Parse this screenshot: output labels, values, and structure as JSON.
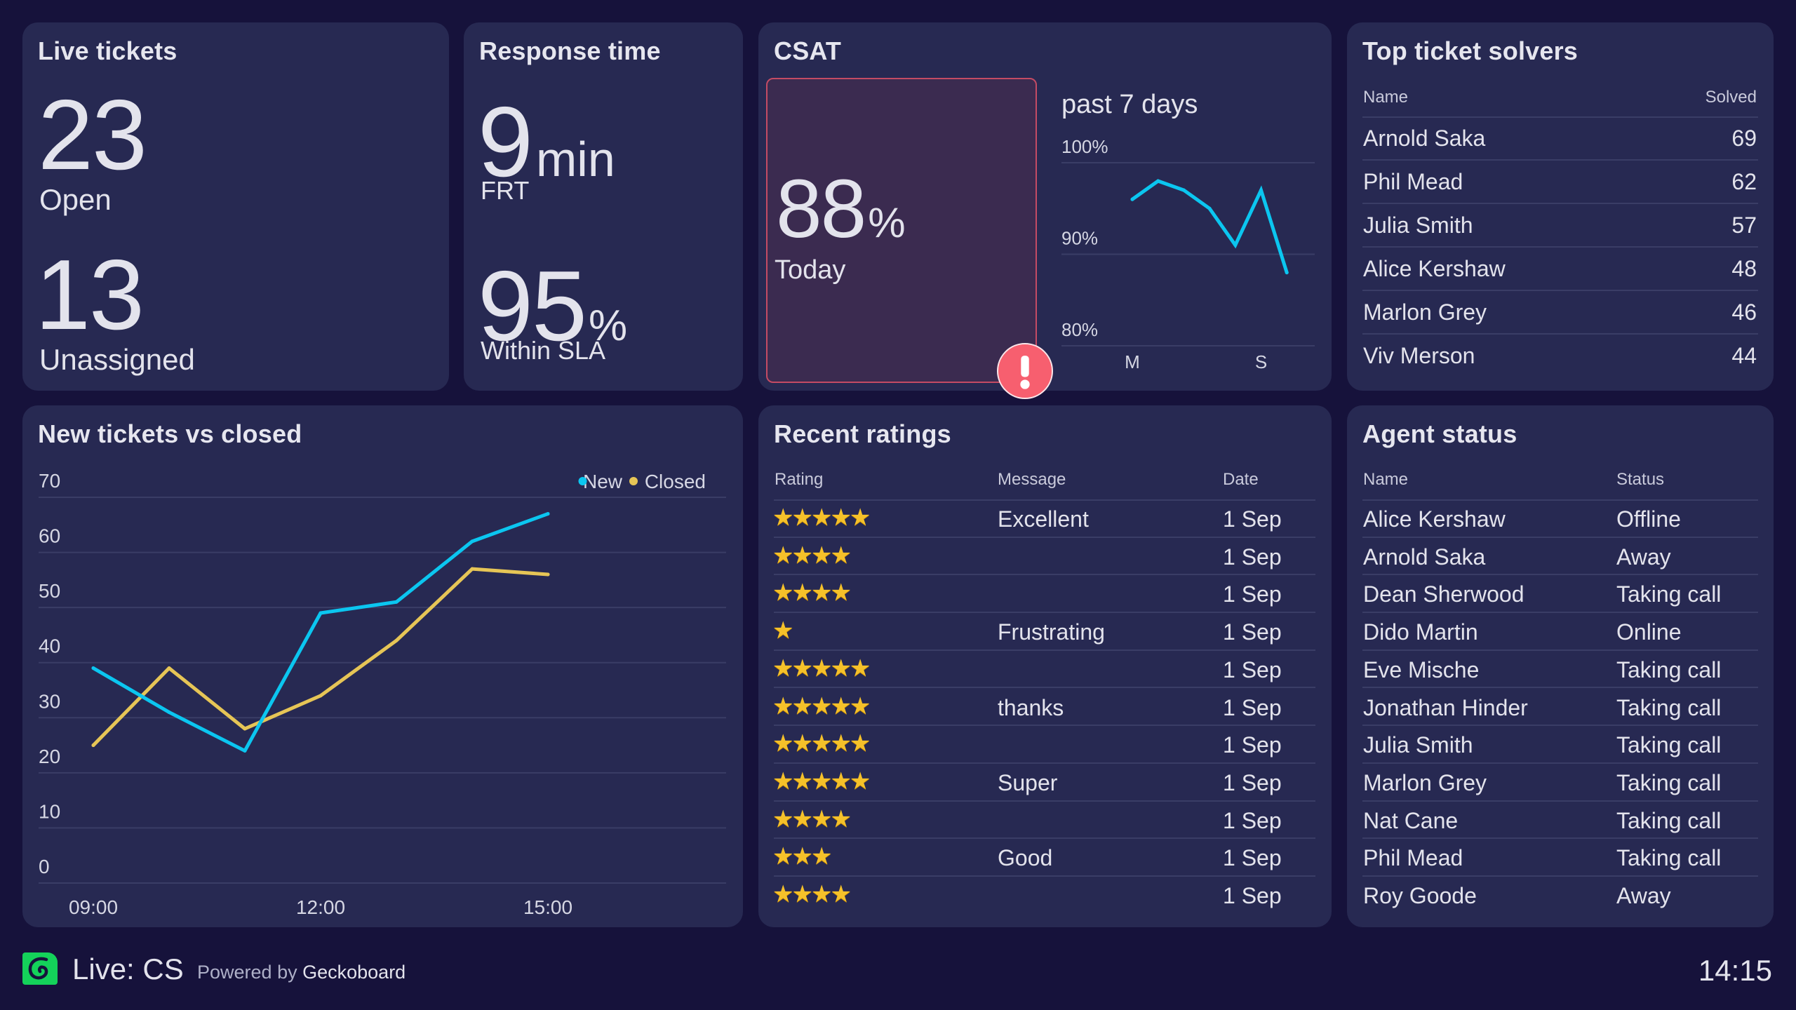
{
  "live_tickets": {
    "title": "Live tickets",
    "open_value": "23",
    "open_label": "Open",
    "unassigned_value": "13",
    "unassigned_label": "Unassigned"
  },
  "response_time": {
    "title": "Response time",
    "frt_value": "9",
    "frt_unit": "min",
    "frt_label": "FRT",
    "sla_value": "95",
    "sla_unit": "%",
    "sla_label": "Within SLA"
  },
  "csat": {
    "title": "CSAT",
    "today_value": "88",
    "today_unit": "%",
    "today_label": "Today",
    "period_label": "past 7 days",
    "alert_icon": "exclamation-icon",
    "colors": {
      "line": "#0bc6f0",
      "alert": "#f75f6f",
      "alert_border": "#c44b64"
    }
  },
  "top_solvers": {
    "title": "Top ticket solvers",
    "columns": [
      "Name",
      "Solved"
    ],
    "rows": [
      {
        "name": "Arnold Saka",
        "solved": "69"
      },
      {
        "name": "Phil Mead",
        "solved": "62"
      },
      {
        "name": "Julia Smith",
        "solved": "57"
      },
      {
        "name": "Alice Kershaw",
        "solved": "48"
      },
      {
        "name": "Marlon Grey",
        "solved": "46"
      },
      {
        "name": "Viv Merson",
        "solved": "44"
      }
    ]
  },
  "new_vs_closed": {
    "title": "New tickets vs closed"
  },
  "recent_ratings": {
    "title": "Recent ratings",
    "columns": [
      "Rating",
      "Message",
      "Date"
    ],
    "rows": [
      {
        "stars": 5,
        "message": "Excellent",
        "date": "1 Sep"
      },
      {
        "stars": 4,
        "message": "",
        "date": "1 Sep"
      },
      {
        "stars": 4,
        "message": "",
        "date": "1 Sep"
      },
      {
        "stars": 1,
        "message": "Frustrating",
        "date": "1 Sep"
      },
      {
        "stars": 5,
        "message": "",
        "date": "1 Sep"
      },
      {
        "stars": 5,
        "message": "thanks",
        "date": "1 Sep"
      },
      {
        "stars": 5,
        "message": "",
        "date": "1 Sep"
      },
      {
        "stars": 5,
        "message": "Super",
        "date": "1 Sep"
      },
      {
        "stars": 4,
        "message": "",
        "date": "1 Sep"
      },
      {
        "stars": 3,
        "message": "Good",
        "date": "1 Sep"
      },
      {
        "stars": 4,
        "message": "",
        "date": "1 Sep"
      }
    ]
  },
  "agent_status": {
    "title": "Agent status",
    "columns": [
      "Name",
      "Status"
    ],
    "rows": [
      {
        "name": "Alice Kershaw",
        "status": "Offline"
      },
      {
        "name": "Arnold Saka",
        "status": "Away"
      },
      {
        "name": "Dean Sherwood",
        "status": "Taking call"
      },
      {
        "name": "Dido Martin",
        "status": "Online"
      },
      {
        "name": "Eve Mische",
        "status": "Taking call"
      },
      {
        "name": "Jonathan Hinder",
        "status": "Taking call"
      },
      {
        "name": "Julia Smith",
        "status": "Taking call"
      },
      {
        "name": "Marlon Grey",
        "status": "Taking call"
      },
      {
        "name": "Nat Cane",
        "status": "Taking call"
      },
      {
        "name": "Phil Mead",
        "status": "Taking call"
      },
      {
        "name": "Roy Goode",
        "status": "Away"
      }
    ]
  },
  "footer": {
    "logo_icon": "geckoboard-logo-icon",
    "dashboard_title": "Live: CS",
    "powered_by": "Powered by",
    "brand": "Geckoboard",
    "clock": "14:15"
  },
  "chart_data": [
    {
      "id": "new_vs_closed",
      "type": "line",
      "title": "New tickets vs closed",
      "x": [
        "09:00",
        "10:00",
        "11:00",
        "12:00",
        "13:00",
        "14:00",
        "15:00"
      ],
      "x_tick_labels": [
        "09:00",
        "12:00",
        "15:00"
      ],
      "series": [
        {
          "name": "New",
          "color": "#0bc6f0",
          "values": [
            39,
            31,
            24,
            49,
            51,
            62,
            67
          ]
        },
        {
          "name": "Closed",
          "color": "#e6c556",
          "values": [
            25,
            39,
            28,
            34,
            44,
            57,
            56
          ]
        }
      ],
      "xlabel": "",
      "ylabel": "",
      "ylim": [
        0,
        70
      ],
      "y_ticks": [
        0,
        10,
        20,
        30,
        40,
        50,
        60,
        70
      ],
      "grid": true,
      "legend": "top-right"
    },
    {
      "id": "csat_past_7_days",
      "type": "line",
      "title": "past 7 days",
      "x": [
        "M",
        "T",
        "W",
        "T",
        "F",
        "S",
        "S"
      ],
      "x_tick_labels": [
        "M",
        "S"
      ],
      "series": [
        {
          "name": "CSAT",
          "color": "#0bc6f0",
          "values": [
            96,
            98,
            97,
            95,
            91,
            97,
            88
          ]
        }
      ],
      "ylim": [
        80,
        100
      ],
      "y_ticks": [
        "80%",
        "90%",
        "100%"
      ],
      "grid": true,
      "legend": "none"
    }
  ]
}
